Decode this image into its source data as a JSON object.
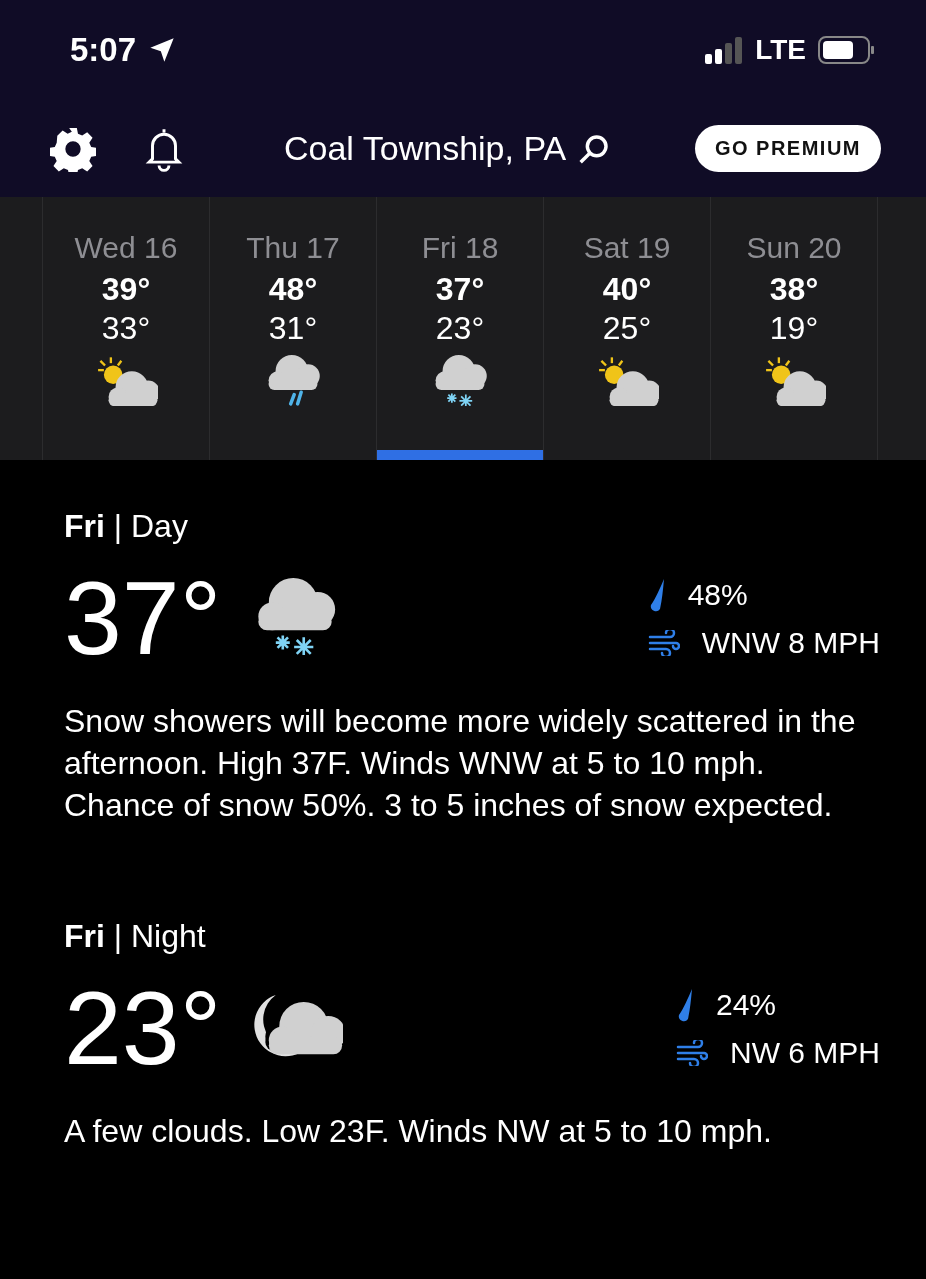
{
  "status_bar": {
    "time": "5:07",
    "network": "LTE"
  },
  "header": {
    "location": "Coal Township, PA",
    "premium_button": "GO PREMIUM"
  },
  "days": [
    {
      "label": "Wed 16",
      "high": "39°",
      "low": "33°",
      "kind": "partly_sunny",
      "selected": false
    },
    {
      "label": "Thu 17",
      "high": "48°",
      "low": "31°",
      "kind": "rain",
      "selected": false
    },
    {
      "label": "Fri 18",
      "high": "37°",
      "low": "23°",
      "kind": "snow",
      "selected": true
    },
    {
      "label": "Sat 19",
      "high": "40°",
      "low": "25°",
      "kind": "partly_sunny",
      "selected": false
    },
    {
      "label": "Sun 20",
      "high": "38°",
      "low": "19°",
      "kind": "partly_sunny",
      "selected": false
    }
  ],
  "periods": [
    {
      "title": "**Fri** | Day",
      "temp": "37°",
      "kind": "snow",
      "precip": "48%",
      "wind": "WNW 8 MPH",
      "description": "Snow showers will become more widely scattered in the afternoon. High 37F. Winds WNW at 5 to 10 mph. Chance of snow 50%. 3 to 5 inches of snow expected."
    },
    {
      "title": "**Fri** | Night",
      "temp": "23°",
      "kind": "night_cloudy",
      "precip": "24%",
      "wind": "NW 6 MPH",
      "description": "A few clouds. Low 23F. Winds NW at 5 to 10 mph."
    }
  ]
}
